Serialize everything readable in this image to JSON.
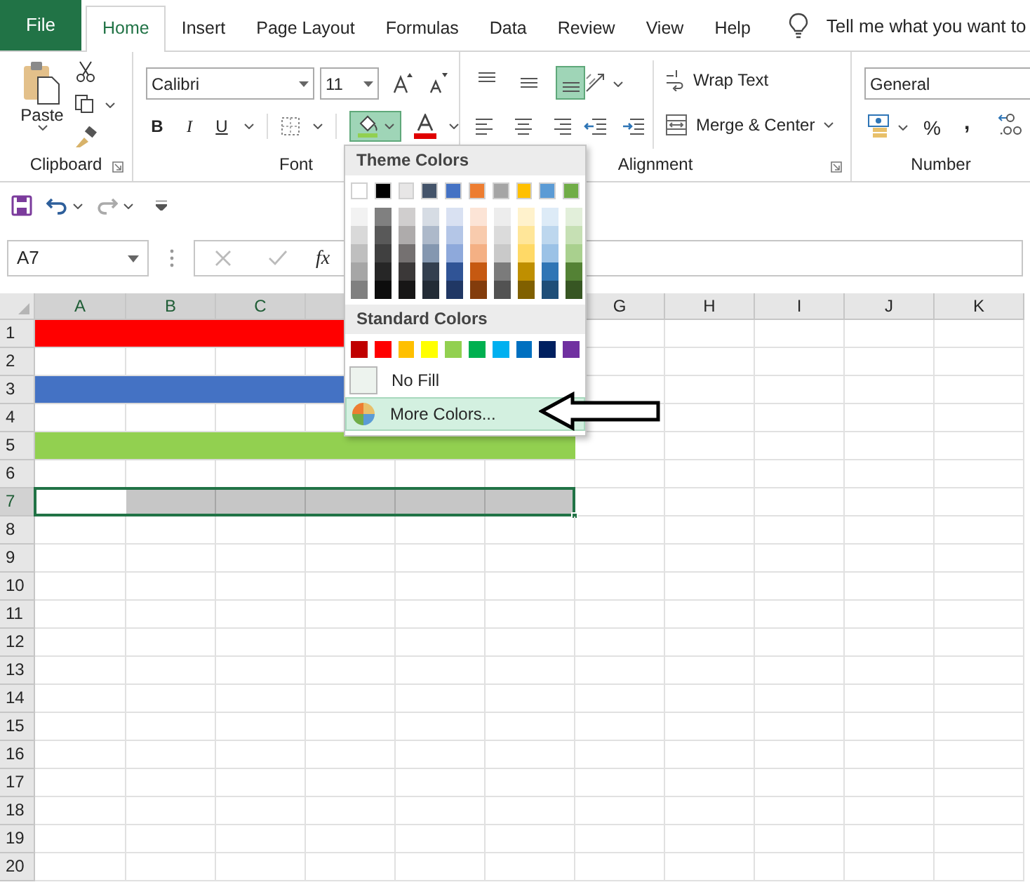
{
  "tabs": [
    {
      "label": "File",
      "kind": "file",
      "selected": false
    },
    {
      "label": "Home",
      "kind": "tab",
      "selected": true
    },
    {
      "label": "Insert",
      "kind": "tab",
      "selected": false
    },
    {
      "label": "Page Layout",
      "kind": "tab",
      "selected": false
    },
    {
      "label": "Formulas",
      "kind": "tab",
      "selected": false
    },
    {
      "label": "Data",
      "kind": "tab",
      "selected": false
    },
    {
      "label": "Review",
      "kind": "tab",
      "selected": false
    },
    {
      "label": "View",
      "kind": "tab",
      "selected": false
    },
    {
      "label": "Help",
      "kind": "tab",
      "selected": false
    }
  ],
  "tell_me": {
    "placeholder": "Tell me what you want to"
  },
  "ribbon": {
    "clipboard": {
      "paste": "Paste",
      "label": "Clipboard"
    },
    "font": {
      "font_name": "Calibri",
      "font_size": "11",
      "bold": "B",
      "italic": "I",
      "underline": "U",
      "fill_pressed": true,
      "label": "Font"
    },
    "alignment": {
      "vertical": [
        {
          "selected": false
        },
        {
          "selected": false
        },
        {
          "selected": true
        }
      ],
      "wrap_text": "Wrap Text",
      "merge": "Merge & Center",
      "label": "Alignment"
    },
    "number": {
      "format": "General",
      "percent": "%",
      "comma": ",",
      "label": "Number"
    }
  },
  "name_box": "A7",
  "formula_bar": {
    "function": "fx"
  },
  "columns": [
    "A",
    "B",
    "C",
    null,
    null,
    null,
    "G",
    "H",
    "I",
    "J",
    "K"
  ],
  "rows": [
    {
      "label": "1",
      "color": "#ff0000",
      "selected": false
    },
    {
      "label": "2",
      "selected": false
    },
    {
      "label": "3",
      "color": "#4472c4",
      "selected": false
    },
    {
      "label": "4",
      "selected": false
    },
    {
      "label": "5",
      "color": "#92d050",
      "selected": false
    },
    {
      "label": "6",
      "selected": false
    },
    {
      "label": "7",
      "color": "#c6c6c6",
      "selected": true
    },
    {
      "label": "8",
      "selected": false
    },
    {
      "label": "9",
      "selected": false
    },
    {
      "label": "10",
      "selected": false
    },
    {
      "label": "11",
      "selected": false
    },
    {
      "label": "12",
      "selected": false
    },
    {
      "label": "13",
      "selected": false
    },
    {
      "label": "14",
      "selected": false
    },
    {
      "label": "15",
      "selected": false
    },
    {
      "label": "16",
      "selected": false
    },
    {
      "label": "17",
      "selected": false
    },
    {
      "label": "18",
      "selected": false
    },
    {
      "label": "19",
      "selected": false
    },
    {
      "label": "20",
      "selected": false
    }
  ],
  "fill_menu": {
    "theme_title": "Theme Colors",
    "theme_colors": [
      {
        "color": "#ffffff",
        "shades": [
          {
            "color": "#f2f2f2"
          },
          {
            "color": "#d9d9d9"
          },
          {
            "color": "#bfbfbf"
          },
          {
            "color": "#a6a6a6"
          },
          {
            "color": "#808080"
          }
        ]
      },
      {
        "color": "#000000",
        "shades": [
          {
            "color": "#808080"
          },
          {
            "color": "#595959"
          },
          {
            "color": "#404040"
          },
          {
            "color": "#262626"
          },
          {
            "color": "#0d0d0d"
          }
        ]
      },
      {
        "color": "#e7e6e6",
        "shades": [
          {
            "color": "#d0cece"
          },
          {
            "color": "#aeabab"
          },
          {
            "color": "#757171"
          },
          {
            "color": "#3b3838"
          },
          {
            "color": "#171616"
          }
        ]
      },
      {
        "color": "#44546a",
        "shades": [
          {
            "color": "#d6dce4"
          },
          {
            "color": "#adb9ca"
          },
          {
            "color": "#8497b0"
          },
          {
            "color": "#333f4f"
          },
          {
            "color": "#222b35"
          }
        ]
      },
      {
        "color": "#4472c4",
        "shades": [
          {
            "color": "#d9e1f2"
          },
          {
            "color": "#b4c6e7"
          },
          {
            "color": "#8ea9db"
          },
          {
            "color": "#305496"
          },
          {
            "color": "#203764"
          }
        ]
      },
      {
        "color": "#ed7d31",
        "shades": [
          {
            "color": "#fce4d6"
          },
          {
            "color": "#f8cbad"
          },
          {
            "color": "#f4b084"
          },
          {
            "color": "#c65911"
          },
          {
            "color": "#833c0c"
          }
        ]
      },
      {
        "color": "#a5a5a5",
        "shades": [
          {
            "color": "#ededed"
          },
          {
            "color": "#dbdbdb"
          },
          {
            "color": "#c9c9c9"
          },
          {
            "color": "#7b7b7b"
          },
          {
            "color": "#525252"
          }
        ]
      },
      {
        "color": "#ffc000",
        "shades": [
          {
            "color": "#fff2cc"
          },
          {
            "color": "#ffe699"
          },
          {
            "color": "#ffd966"
          },
          {
            "color": "#bf8f00"
          },
          {
            "color": "#806000"
          }
        ]
      },
      {
        "color": "#5b9bd5",
        "shades": [
          {
            "color": "#ddebf7"
          },
          {
            "color": "#bdd7ee"
          },
          {
            "color": "#9bc2e6"
          },
          {
            "color": "#2f75b5"
          },
          {
            "color": "#1f4e78"
          }
        ]
      },
      {
        "color": "#70ad47",
        "shades": [
          {
            "color": "#e2efda"
          },
          {
            "color": "#c6e0b4"
          },
          {
            "color": "#a9d08e"
          },
          {
            "color": "#548235"
          },
          {
            "color": "#375623"
          }
        ]
      }
    ],
    "standard_title": "Standard Colors",
    "standard_colors": [
      {
        "color": "#c00000"
      },
      {
        "color": "#ff0000"
      },
      {
        "color": "#ffc000"
      },
      {
        "color": "#ffff00"
      },
      {
        "color": "#92d050"
      },
      {
        "color": "#00b050"
      },
      {
        "color": "#00b0f0"
      },
      {
        "color": "#0070c0"
      },
      {
        "color": "#002060"
      },
      {
        "color": "#7030a0"
      }
    ],
    "no_fill": {
      "label": "No Fill",
      "selected": false
    },
    "more_colors": {
      "label": "More Colors...",
      "selected": true
    }
  }
}
